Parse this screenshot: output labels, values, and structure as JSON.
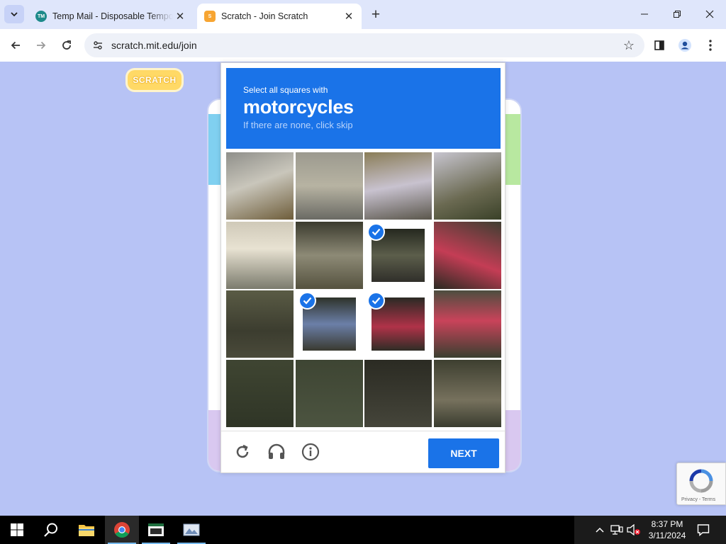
{
  "browser": {
    "tabs": [
      {
        "title": "Temp Mail - Disposable Temporary Email",
        "favicon": "temp-mail-icon",
        "active": false
      },
      {
        "title": "Scratch - Join Scratch",
        "favicon": "scratch-cat-icon",
        "active": true
      }
    ],
    "url": "scratch.mit.edu/join"
  },
  "page": {
    "logo_text": "SCRATCH"
  },
  "captcha": {
    "instruction": "Select all squares with",
    "target": "motorcycles",
    "hint": "If there are none, click skip",
    "grid_size": 4,
    "selected_tiles": [
      6,
      9,
      10
    ],
    "next_label": "NEXT",
    "badge_links": "Privacy - Terms",
    "colors": {
      "accent": "#1a73e8"
    }
  },
  "taskbar": {
    "time": "8:37 PM",
    "date": "3/11/2024"
  }
}
